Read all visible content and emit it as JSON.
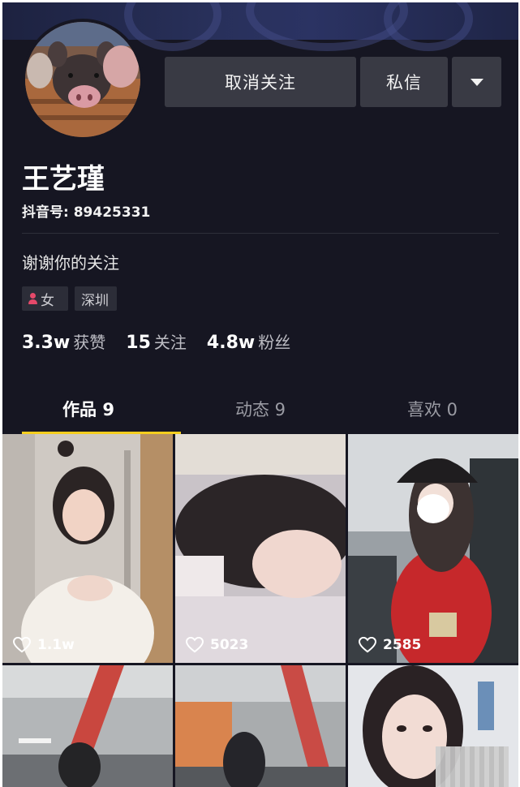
{
  "profile": {
    "name": "王艺瑾",
    "douyin_id": "抖音号: 89425331",
    "signature": "谢谢你的关注",
    "tags": {
      "gender": "女",
      "city": "深圳"
    }
  },
  "actions": {
    "unfollow": "取消关注",
    "message": "私信"
  },
  "stats": [
    {
      "num": "3.3w",
      "label": "获赞"
    },
    {
      "num": "15",
      "label": "关注"
    },
    {
      "num": "4.8w",
      "label": "粉丝"
    }
  ],
  "tabs": [
    {
      "label": "作品 9"
    },
    {
      "label": "动态 9"
    },
    {
      "label": "喜欢 0"
    }
  ],
  "videos": [
    {
      "likes": "1.1w"
    },
    {
      "likes": "5023"
    },
    {
      "likes": "2585"
    }
  ],
  "colors": {
    "background": "#161622",
    "button": "#393a44",
    "accent": "#f5cd1e",
    "gender_icon": "#e6496a"
  }
}
